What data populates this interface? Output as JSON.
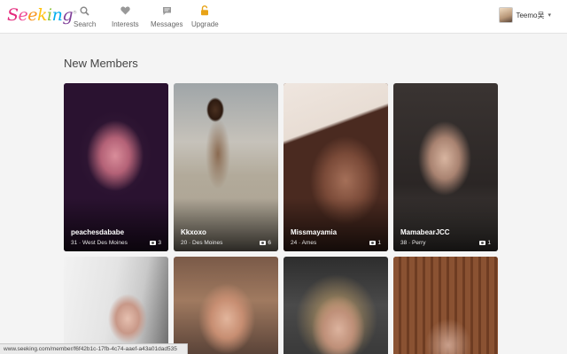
{
  "header": {
    "logo_text": "Seeking",
    "logo_mark": "®",
    "nav": [
      {
        "label": "Search",
        "icon": "search-icon"
      },
      {
        "label": "Interests",
        "icon": "heart-icon"
      },
      {
        "label": "Messages",
        "icon": "chat-icon"
      },
      {
        "label": "Upgrade",
        "icon": "lock-icon",
        "accent": "#e8a317"
      }
    ],
    "user_name": "Teemo吴"
  },
  "main": {
    "section_title": "New Members",
    "members": [
      {
        "username": "peachesdababe",
        "meta": "31 · West Des Moines",
        "photos": "3"
      },
      {
        "username": "Kkxoxo",
        "meta": "20 · Des Moines",
        "photos": "6"
      },
      {
        "username": "Missmayamia",
        "meta": "24 · Ames",
        "photos": "1"
      },
      {
        "username": "MamabearJCC",
        "meta": "38 · Perry",
        "photos": "1"
      }
    ]
  },
  "status_url": "www.seeking.com/member/f6f42b1c-17fb-4c74-aaef-a43a01dad535",
  "colors": {
    "logo_s": "#e4297c",
    "logo_e1": "#f04e98",
    "logo_e2": "#f7941d",
    "logo_k": "#ffc20e",
    "logo_i": "#8dc63f",
    "logo_n": "#00aeef",
    "logo_g": "#7f3f98",
    "upgrade": "#e8a317"
  }
}
